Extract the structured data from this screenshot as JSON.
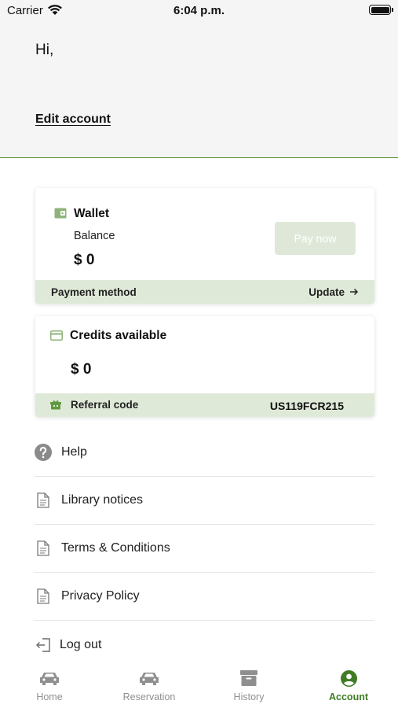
{
  "status_bar": {
    "carrier": "Carrier",
    "time": "6:04 p.m."
  },
  "header": {
    "greeting": "Hi,",
    "edit_account": "Edit account"
  },
  "wallet": {
    "title": "Wallet",
    "balance_label": "Balance",
    "balance_value": "$ 0",
    "pay_button": "Pay now",
    "payment_method_label": "Payment method",
    "update_label": "Update"
  },
  "credits": {
    "title": "Credits available",
    "value": "$ 0",
    "referral_label": "Referral code",
    "referral_code": "US119FCR215"
  },
  "menu": [
    {
      "label": "Help",
      "icon": "help-icon"
    },
    {
      "label": "Library notices",
      "icon": "document-icon"
    },
    {
      "label": "Terms & Conditions",
      "icon": "document-icon"
    },
    {
      "label": "Privacy Policy",
      "icon": "document-icon"
    },
    {
      "label": "Log out",
      "icon": "logout-icon"
    }
  ],
  "tabs": [
    {
      "label": "Home",
      "icon": "car-icon",
      "active": false
    },
    {
      "label": "Reservation",
      "icon": "car-icon",
      "active": false
    },
    {
      "label": "History",
      "icon": "archive-icon",
      "active": false
    },
    {
      "label": "Account",
      "icon": "account-icon",
      "active": true
    }
  ],
  "colors": {
    "accent": "#3f7d22",
    "card_footer_bg": "#dfe9d8",
    "disabled_button_bg": "#dfe8d8",
    "header_bg": "#f5f5f5"
  }
}
